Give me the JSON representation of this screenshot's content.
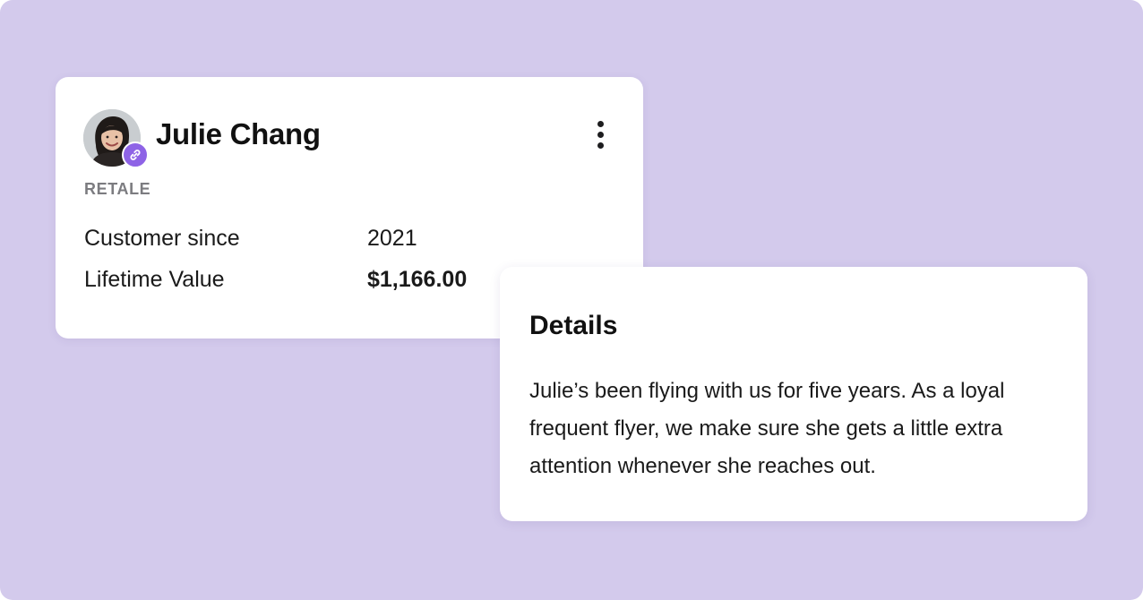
{
  "customer": {
    "name": "Julie Chang",
    "segment": "RETALE",
    "avatar_icon": "person-photo",
    "badge_icon": "link-icon",
    "fields": [
      {
        "label": "Customer since",
        "value": "2021"
      },
      {
        "label": "Lifetime Value",
        "value": "$1,166.00"
      }
    ]
  },
  "details": {
    "title": "Details",
    "body": "Julie’s been flying with us for five years. As a loyal frequent flyer, we make sure she gets a little extra attention whenever she reaches out."
  },
  "colors": {
    "background": "#d3caec",
    "badge": "#8e63e6",
    "card": "#ffffff",
    "muted_label": "#7c7c80"
  }
}
